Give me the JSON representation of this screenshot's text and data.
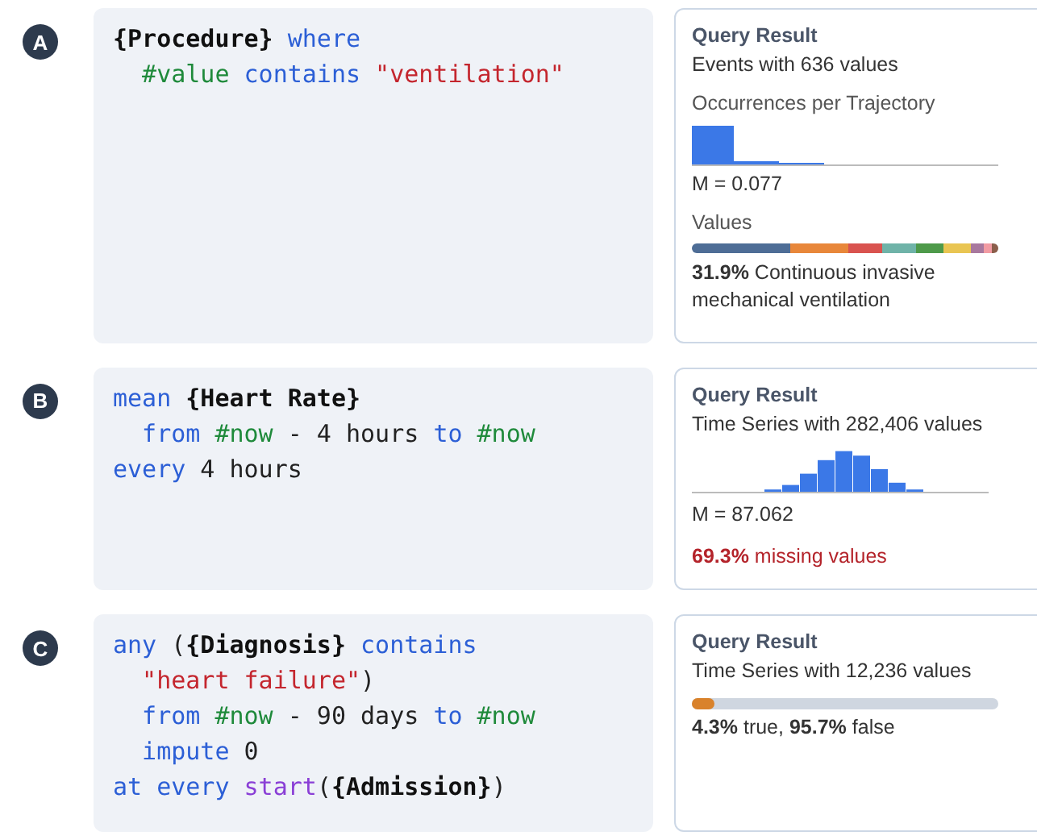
{
  "queries": [
    {
      "badge": "A",
      "code": [
        [
          {
            "text": "{Procedure}",
            "kind": "concept"
          },
          {
            "text": " where",
            "kind": "keyword"
          }
        ],
        [
          {
            "text": "  #value",
            "kind": "variable"
          },
          {
            "text": " contains",
            "kind": "keyword"
          },
          {
            "text": " \"ventilation\"",
            "kind": "string"
          }
        ]
      ],
      "result": {
        "kind": "events",
        "title": "Query Result",
        "summary": "Events with 636 values",
        "histogram_label": "Occurrences per Trajectory",
        "mean": "M = 0.077",
        "values_label": "Values",
        "top_value": "**31.9%** Continuous invasive mechanical ventilation"
      }
    },
    {
      "badge": "B",
      "code": [
        [
          {
            "text": "mean",
            "kind": "keyword"
          },
          {
            "text": " {Heart Rate}",
            "kind": "concept"
          }
        ],
        [
          {
            "text": "  from",
            "kind": "keyword"
          },
          {
            "text": " #now",
            "kind": "variable"
          },
          {
            "text": " - 4 hours ",
            "kind": "plain"
          },
          {
            "text": "to",
            "kind": "keyword"
          },
          {
            "text": " #now",
            "kind": "variable"
          }
        ],
        [
          {
            "text": "every",
            "kind": "keyword"
          },
          {
            "text": " 4 hours",
            "kind": "plain"
          }
        ]
      ],
      "result": {
        "kind": "series",
        "title": "Query Result",
        "summary": "Time Series with 282,406 values",
        "mean": "M = 87.062",
        "missing": "**69.3%** missing values"
      }
    },
    {
      "badge": "C",
      "code": [
        [
          {
            "text": "any",
            "kind": "keyword"
          },
          {
            "text": " (",
            "kind": "plain"
          },
          {
            "text": "{Diagnosis}",
            "kind": "concept"
          },
          {
            "text": " contains",
            "kind": "keyword"
          }
        ],
        [
          {
            "text": "  \"heart failure\"",
            "kind": "string"
          },
          {
            "text": ")",
            "kind": "plain"
          }
        ],
        [
          {
            "text": "  from",
            "kind": "keyword"
          },
          {
            "text": " #now",
            "kind": "variable"
          },
          {
            "text": " - 90 days ",
            "kind": "plain"
          },
          {
            "text": "to",
            "kind": "keyword"
          },
          {
            "text": " #now",
            "kind": "variable"
          }
        ],
        [
          {
            "text": "  impute",
            "kind": "keyword"
          },
          {
            "text": " 0",
            "kind": "plain"
          }
        ],
        [
          {
            "text": "at every",
            "kind": "keyword"
          },
          {
            "text": " start",
            "kind": "function"
          },
          {
            "text": "(",
            "kind": "plain"
          },
          {
            "text": "{Admission}",
            "kind": "concept"
          },
          {
            "text": ")",
            "kind": "plain"
          }
        ]
      ],
      "result": {
        "kind": "boolean",
        "title": "Query Result",
        "summary": "Time Series with 12,236 values",
        "bar": {
          "color": "#d9822b",
          "level": 0.043
        },
        "split": "**4.3%** true, **95.7%** false"
      }
    }
  ]
}
